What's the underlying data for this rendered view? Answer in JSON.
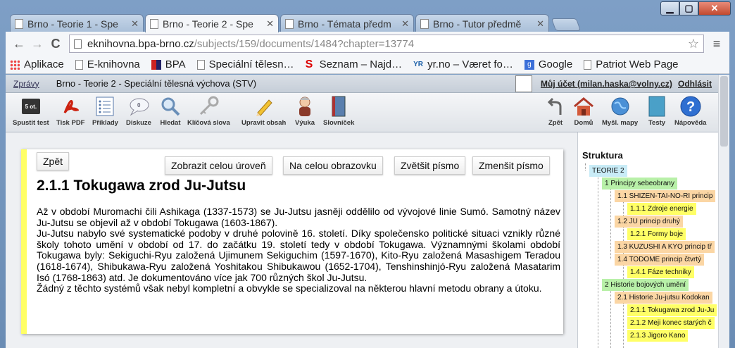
{
  "window": {
    "controls": {
      "minimize": "▁",
      "maximize": "▢",
      "close": "✕"
    }
  },
  "tabs": [
    {
      "title": "Brno - Teorie 1 - Spe",
      "active": false
    },
    {
      "title": "Brno - Teorie 2 - Spe",
      "active": true
    },
    {
      "title": "Brno - Témata předm",
      "active": false
    },
    {
      "title": "Brno - Tutor předmě",
      "active": false
    }
  ],
  "toolbar": {
    "back": "←",
    "forward": "→",
    "reload": "C",
    "url_host": "eknihovna.bpa-brno.cz",
    "url_path": "/subjects/159/documents/1484?chapter=13774",
    "star": "☆",
    "menu": "≡"
  },
  "bookmarks": [
    {
      "label": "Aplikace",
      "icon": "apps-grid-icon",
      "color": "#d33"
    },
    {
      "label": "E-knihovna",
      "icon": "page-icon",
      "color": "#888"
    },
    {
      "label": "BPA",
      "icon": "bpa-logo-icon",
      "color": "#c22"
    },
    {
      "label": "Speciální tělesn…",
      "icon": "page-icon",
      "color": "#888"
    },
    {
      "label": "Seznam – Najd…",
      "icon": "seznam-logo-icon",
      "color": "#d00"
    },
    {
      "label": "yr.no – Været fo…",
      "icon": "yr-logo-icon",
      "color": "#1a5fa8"
    },
    {
      "label": "Google",
      "icon": "google-logo-icon",
      "color": "#3b6fd8"
    },
    {
      "label": "Patriot Web Page",
      "icon": "page-icon",
      "color": "#888"
    }
  ],
  "app_header": {
    "messages": "Zprávy",
    "document_title": "Brno - Teorie 2 - Speciální tělesná výchova (STV)",
    "account": "Můj účet (milan.haska@volny.cz)",
    "logout": "Odhlásit"
  },
  "ribbon": {
    "left": [
      {
        "label": "Spustit test",
        "icon": "test-5ot-icon"
      },
      {
        "label": "Tisk PDF",
        "icon": "pdf-icon"
      },
      {
        "label": "Příklady",
        "icon": "list-icon"
      },
      {
        "label": "Diskuze",
        "icon": "speech-bubble-icon"
      },
      {
        "label": "Hledat",
        "icon": "magnifier-icon"
      },
      {
        "label": "Klíčová slova",
        "icon": "key-icon"
      },
      {
        "label": "Upravit obsah",
        "icon": "pencil-icon"
      },
      {
        "label": "Výuka",
        "icon": "teacher-icon"
      },
      {
        "label": "Slovníček",
        "icon": "book-icon"
      }
    ],
    "right": [
      {
        "label": "Zpět",
        "icon": "back-arrow-icon"
      },
      {
        "label": "Domů",
        "icon": "home-icon"
      },
      {
        "label": "Myšl. mapy",
        "icon": "globe-icon"
      },
      {
        "label": "Testy",
        "icon": "tests-icon"
      },
      {
        "label": "Nápověda",
        "icon": "help-icon"
      }
    ]
  },
  "content": {
    "back_button": "Zpět",
    "buttons": [
      "Zobrazit celou úroveň",
      "Na celou obrazovku",
      "Zvětšit písmo",
      "Zmenšit písmo"
    ],
    "heading": "2.1.1 Tokugawa zrod Ju-Jutsu",
    "paragraphs": [
      "Až v období Muromachi čili Ashikaga (1337-1573) se Ju-Jutsu jasněji oddělilo od vývojové linie Sumó. Samotný název Ju-Jutsu se objevil až v období Tokugawa (1603-1867).",
      "Ju-Jutsu nabylo své systematické podoby v druhé polovině 16. století. Díky společensko politické situaci vznikly různé školy tohoto umění v období od 17. do začátku 19. století tedy v období Tokugawa. Významnými školami období Tokugawa byly: Sekiguchi-Ryu založená Ujimunem Sekiguchim (1597-1670), Kito-Ryu založená Masashigem Teradou (1618-1674), Shibukawa-Ryu založená Yoshitakou Shibukawou (1652-1704), Tenshinshinjó-Ryu založená Masatarim Isó (1768-1863) atd. Je dokumentováno více jak 700 různých škol Ju-Jutsu.",
      "Žádný z těchto systémů však nebyl kompletní a obvykle se specializoval na některou hlavní metodu obrany a útoku."
    ]
  },
  "sidebar": {
    "title": "Struktura",
    "nodes": [
      {
        "label": "TEORIE 2",
        "level": 0,
        "color": "#c9ecf7"
      },
      {
        "label": "1 Principy sebeobrany",
        "level": 1,
        "color": "#b8f0a8"
      },
      {
        "label": "1.1 SHIZEN-TAI-NO-RI princip",
        "level": 2,
        "color": "#fbd6a4"
      },
      {
        "label": "1.1.1 Zdroje energie",
        "level": 3,
        "color": "#ffff66"
      },
      {
        "label": "1.2 JU princip druhý",
        "level": 2,
        "color": "#fbd6a4"
      },
      {
        "label": "1.2.1 Formy boje",
        "level": 3,
        "color": "#ffff66"
      },
      {
        "label": "1.3 KUZUSHI A KYO princip tř",
        "level": 2,
        "color": "#fbd6a4"
      },
      {
        "label": "1.4 TODOME princip čtvrtý",
        "level": 2,
        "color": "#fbd6a4"
      },
      {
        "label": "1.4.1 Fáze techniky",
        "level": 3,
        "color": "#ffff66"
      },
      {
        "label": "2 Historie bojových umění",
        "level": 1,
        "color": "#b8f0a8"
      },
      {
        "label": "2.1 Historie Ju-jutsu Kodokan",
        "level": 2,
        "color": "#fbd6a4"
      },
      {
        "label": "2.1.1 Tokugawa zrod Ju-Ju",
        "level": 3,
        "color": "#ffff66"
      },
      {
        "label": "2.1.2 Meji konec starých č",
        "level": 3,
        "color": "#ffff66"
      },
      {
        "label": "2.1.3 Jigoro Kano",
        "level": 3,
        "color": "#ffff66"
      }
    ]
  }
}
